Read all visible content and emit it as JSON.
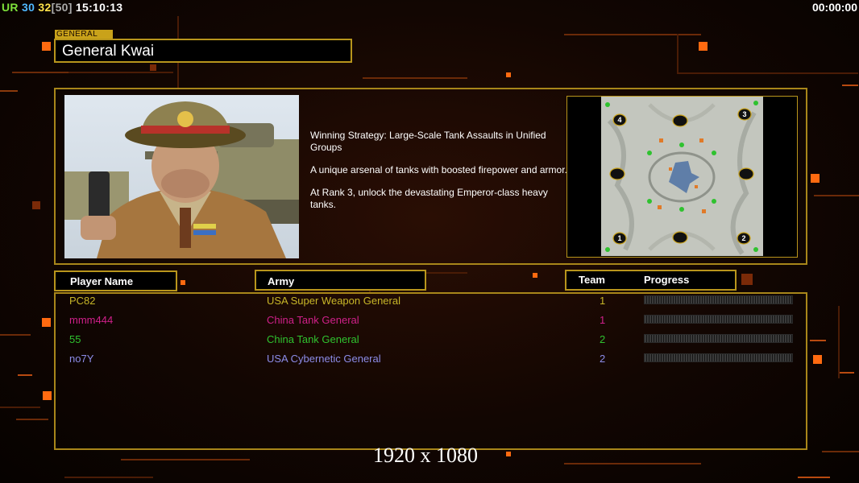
{
  "hud": {
    "ur_label": "UR",
    "ur_value": "30",
    "fps": "32",
    "fps_cap": "[50]",
    "clock": "15:10:13",
    "timer": "00:00:00"
  },
  "header": {
    "tag": "GENERAL",
    "title": "General Kwai"
  },
  "description": {
    "p1": "Winning Strategy: Large-Scale Tank Assaults in Unified Groups",
    "p2": "A unique arsenal of tanks with boosted firepower and armor.",
    "p3": "At Rank 3, unlock the devastating Emperor-class heavy tanks."
  },
  "map": {
    "start_positions": [
      "1",
      "2",
      "3",
      "4"
    ]
  },
  "columns": {
    "player": "Player Name",
    "army": "Army",
    "team": "Team",
    "progress": "Progress"
  },
  "players": [
    {
      "name": "PC82",
      "army": "USA Super Weapon General",
      "team": "1",
      "color": "#c8b628",
      "progress": 0
    },
    {
      "name": "mmm444",
      "army": "China Tank General",
      "team": "1",
      "color": "#d0208a",
      "progress": 0
    },
    {
      "name": "55",
      "army": "China Tank General",
      "team": "2",
      "color": "#2fc22f",
      "progress": 0
    },
    {
      "name": "no7Y",
      "army": "USA Cybernetic General",
      "team": "2",
      "color": "#8c8ce8",
      "progress": 0
    }
  ],
  "resolution": "1920 x 1080"
}
